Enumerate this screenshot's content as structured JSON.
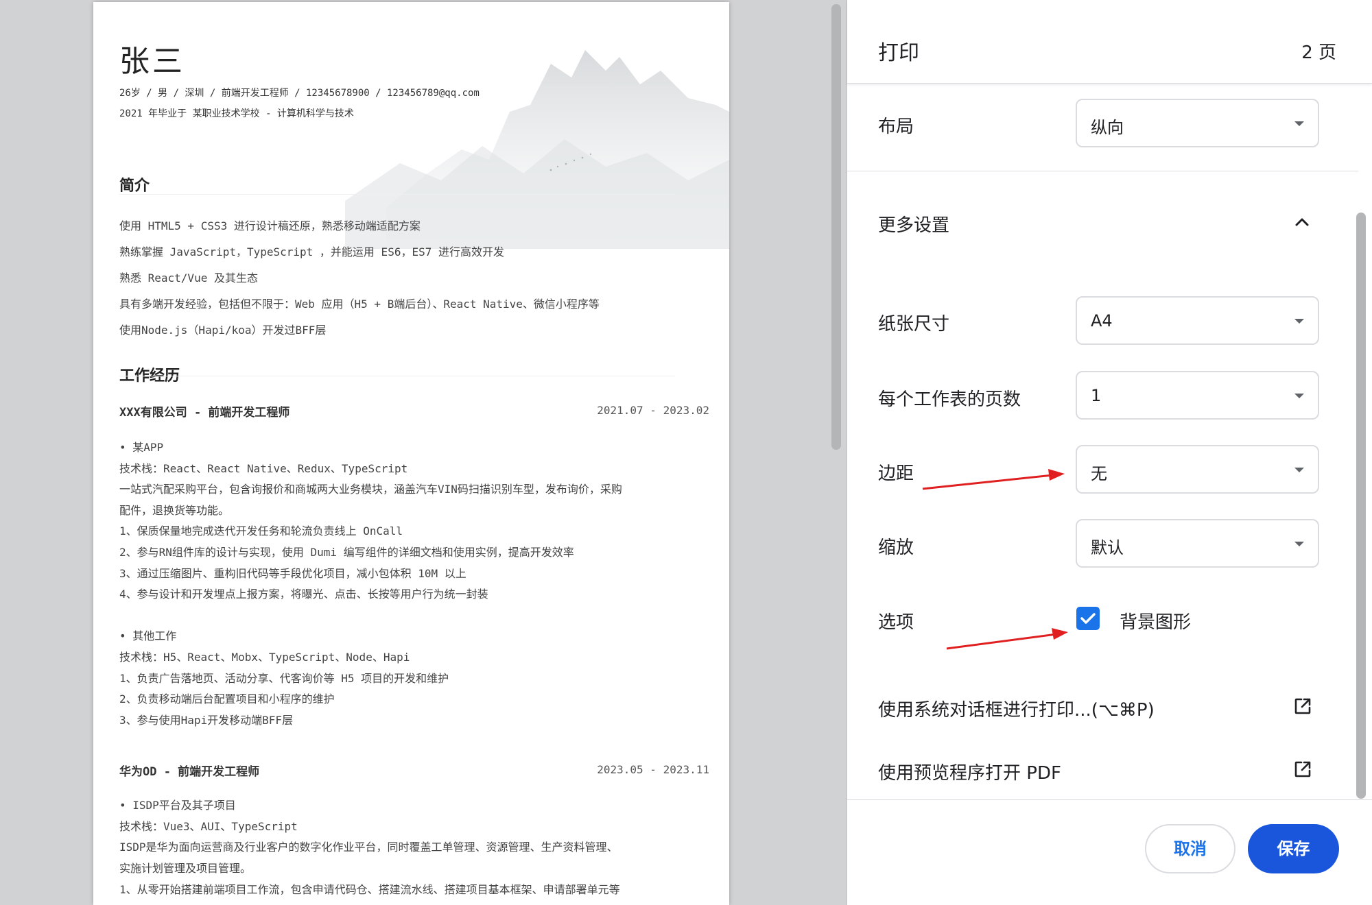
{
  "resume": {
    "name": "张三",
    "meta_line1": "26岁 / 男 / 深圳 / 前端开发工程师 / 12345678900 / 123456789@qq.com",
    "meta_line2": "2021 年毕业于 某职业技术学校 - 计算机科学与技术",
    "intro": {
      "title": "简介",
      "lines": [
        "使用 HTML5 + CSS3 进行设计稿还原，熟悉移动端适配方案",
        "熟练掌握 JavaScript，TypeScript ，并能运用 ES6，ES7 进行高效开发",
        "熟悉 React/Vue 及其生态",
        "具有多端开发经验，包括但不限于：Web 应用（H5 + B端后台）、React Native、微信小程序等",
        "使用Node.js（Hapi/koa）开发过BFF层"
      ]
    },
    "work": {
      "title": "工作经历",
      "jobs": [
        {
          "title": "XXX有限公司 - 前端开发工程师",
          "date": "2021.07 - 2023.02",
          "projects": [
            {
              "lines": [
                "• 某APP",
                "技术栈：React、React Native、Redux、TypeScript",
                "一站式汽配采购平台，包含询报价和商城两大业务模块，涵盖汽车VIN码扫描识别车型，发布询价，采购",
                "配件，退换货等功能。",
                "1、保质保量地完成迭代开发任务和轮流负责线上 OnCall",
                "2、参与RN组件库的设计与实现，使用 Dumi 编写组件的详细文档和使用实例，提高开发效率",
                "3、通过压缩图片、重构旧代码等手段优化项目，减小包体积 10M 以上",
                "4、参与设计和开发埋点上报方案，将曝光、点击、长按等用户行为统一封装"
              ]
            },
            {
              "lines": [
                "• 其他工作",
                "技术栈：H5、React、Mobx、TypeScript、Node、Hapi",
                "1、负责广告落地页、活动分享、代客询价等 H5 项目的开发和维护",
                "2、负责移动端后台配置项目和小程序的维护",
                "3、参与使用Hapi开发移动端BFF层"
              ]
            }
          ]
        },
        {
          "title": "华为OD - 前端开发工程师",
          "date": "2023.05 - 2023.11",
          "projects": [
            {
              "lines": [
                "• ISDP平台及其子项目",
                "技术栈：Vue3、AUI、TypeScript",
                "ISDP是华为面向运营商及行业客户的数字化作业平台，同时覆盖工单管理、资源管理、生产资料管理、",
                "实施计划管理及项目管理。",
                "1、从零开始搭建前端项目工作流，包含申请代码仓、搭建流水线、搭建项目基本框架、申请部署单元等"
              ]
            }
          ]
        }
      ]
    }
  },
  "panel": {
    "title": "打印",
    "page_count": "2 页",
    "layout": {
      "label": "布局",
      "value": "纵向"
    },
    "more_settings": {
      "label": "更多设置",
      "expanded": true
    },
    "paper_size": {
      "label": "纸张尺寸",
      "value": "A4"
    },
    "pages_per_sheet": {
      "label": "每个工作表的页数",
      "value": "1"
    },
    "margins": {
      "label": "边距",
      "value": "无"
    },
    "scale": {
      "label": "缩放",
      "value": "默认"
    },
    "options": {
      "label": "选项",
      "background_graphics": "背景图形",
      "background_graphics_checked": true
    },
    "system_dialog": "使用系统对话框进行打印...(⌥⌘P)",
    "open_pdf": "使用预览程序打开 PDF",
    "cancel": "取消",
    "save": "保存"
  },
  "colors": {
    "accent": "#1a73e8",
    "save_button": "#1a56db",
    "annotation_arrow": "#e02020"
  },
  "icons": {
    "chevron_up": "chevron-up-icon",
    "caret_down": "caret-down-icon",
    "open_external": "open-external-icon",
    "checkmark": "checkmark-icon"
  }
}
